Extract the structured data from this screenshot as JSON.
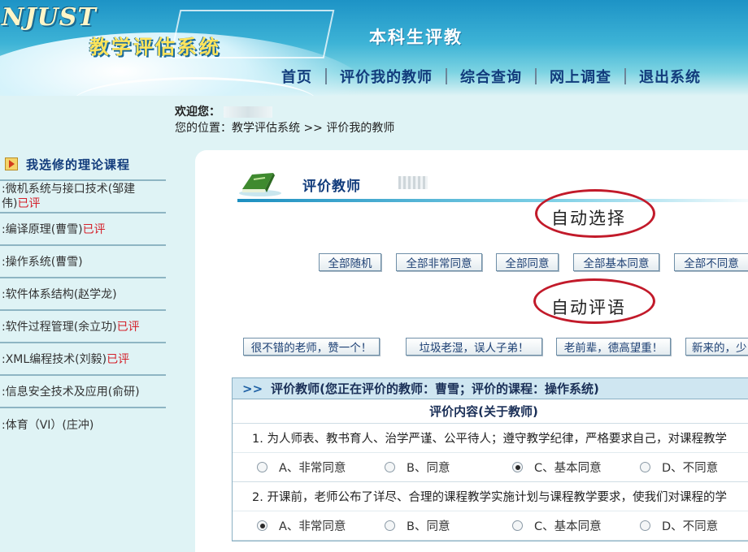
{
  "header": {
    "logo_text": "NJUST",
    "system_name": "教学评估系统",
    "subtitle": "本科生评教",
    "nav": [
      "首页",
      "评价我的教师",
      "综合查询",
      "网上调查",
      "退出系统"
    ]
  },
  "welcome": {
    "greeting": "欢迎您：",
    "location": "您的位置：教学评估系统 >> 评价我的教师"
  },
  "sidebar": {
    "title": "我选修的理论课程",
    "courses": [
      {
        "name": ":微机系统与接口技术(邹建",
        "name2": "伟)",
        "status": "已评"
      },
      {
        "name": ":编译原理(曹雪)",
        "status": "已评"
      },
      {
        "name": ":操作系统(曹雪)",
        "status": ""
      },
      {
        "name": ":软件体系结构(赵学龙)",
        "status": ""
      },
      {
        "name": ":软件过程管理(余立功)",
        "status": "已评"
      },
      {
        "name": ":XML编程技术(刘毅)",
        "status": "已评"
      },
      {
        "name": ":信息安全技术及应用(俞研)",
        "status": ""
      },
      {
        "name": ":体育（VI）(庄冲)",
        "status": ""
      }
    ]
  },
  "panel": {
    "title": "评价教师",
    "annotation_auto_select": "自动选择",
    "annotation_auto_comment": "自动评语",
    "select_buttons": [
      "全部随机",
      "全部非常同意",
      "全部同意",
      "全部基本同意",
      "全部不同意"
    ],
    "comment_buttons": [
      "很不错的老师，赞一个！",
      "垃圾老湿，误人子弟！",
      "老前辈，德高望重！",
      "新来的，少"
    ]
  },
  "evaluation": {
    "header": "评价教师(您正在评价的教师：曹雪；评价的课程：操作系统)",
    "subheader": "评价内容(关于教师)",
    "questions": [
      {
        "text": "1. 为人师表、教书育人、治学严谨、公平待人；遵守教学纪律，严格要求自己，对课程教学",
        "selected": 2
      },
      {
        "text": "2. 开课前，老师公布了详尽、合理的课程教学实施计划与课程教学要求，使我们对课程的学",
        "selected": 0
      }
    ],
    "options": [
      "A、非常同意",
      "B、同意",
      "C、基本同意",
      "D、不同意"
    ]
  },
  "colors": {
    "header_blue": "#1d93c6",
    "nav_text": "#123c7c",
    "evaluated_red": "#d4202a",
    "annotation_ring": "#c21a2a"
  }
}
